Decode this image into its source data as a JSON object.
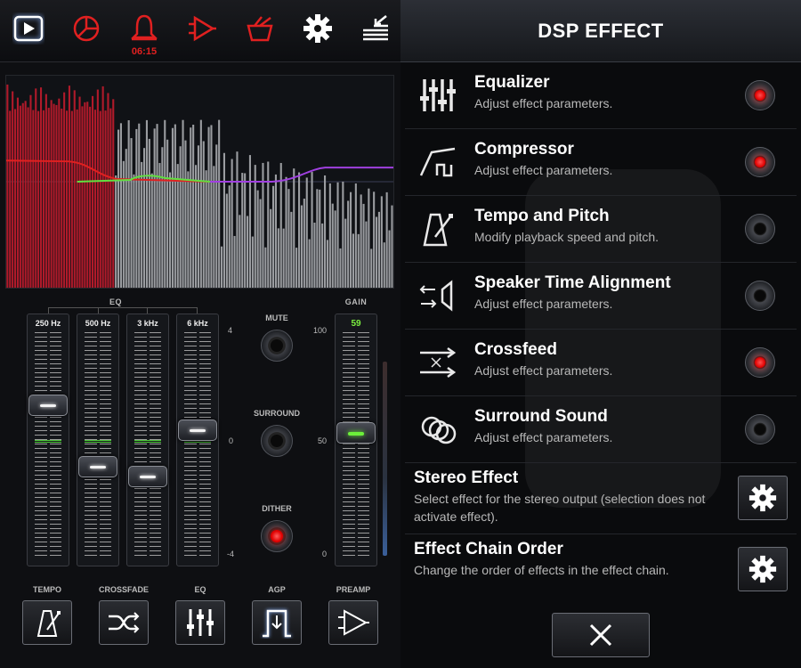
{
  "toolbar": {
    "alarm_time": "06:15",
    "icons": [
      "play-icon",
      "timer-icon",
      "alarm-bell-icon",
      "dsp-amp-icon",
      "library-icon",
      "settings-gear-icon",
      "queue-icon"
    ]
  },
  "spectrum": {
    "bars": [
      120,
      120,
      120,
      120,
      120,
      120,
      120,
      120,
      120,
      120,
      120,
      120,
      120,
      120,
      120,
      120,
      120,
      120,
      120,
      120,
      120,
      120,
      120,
      120,
      120,
      120,
      120,
      120,
      120,
      120,
      120,
      120,
      120,
      120,
      120,
      120,
      120,
      120,
      120,
      120,
      120,
      120,
      120,
      120,
      120,
      120,
      120,
      120,
      120,
      120,
      120,
      120,
      120,
      120,
      120,
      120,
      120,
      120,
      120,
      120,
      120,
      120,
      120,
      120,
      120,
      120,
      120,
      120,
      120,
      120,
      120,
      120,
      120,
      120,
      120,
      120,
      120,
      120,
      120,
      120,
      120,
      120,
      120,
      120,
      120,
      120,
      120,
      120,
      120,
      120,
      120,
      120,
      120,
      120,
      120,
      120,
      120,
      120,
      120,
      120,
      120,
      120,
      120,
      120,
      120,
      120,
      120,
      120,
      120,
      120,
      120,
      120,
      120,
      120,
      120,
      120,
      120,
      120,
      120,
      120,
      120,
      120,
      120,
      120,
      120,
      120,
      120,
      120,
      120,
      120,
      120,
      120,
      120,
      120,
      120,
      120,
      120,
      120,
      120,
      120,
      120,
      120,
      120,
      120,
      120,
      120,
      120,
      120,
      120,
      120,
      120,
      120,
      120,
      120,
      120,
      120,
      120,
      120,
      120,
      120
    ],
    "colors": {
      "bar": "#9a9ca0",
      "bar_top": "#b01a2a",
      "curve_red": "#e02020",
      "curve_green": "#60e040",
      "curve_purple": "#a040e0"
    }
  },
  "eq": {
    "section_label": "EQ",
    "bands": [
      {
        "label": "250 Hz",
        "level": 0.72
      },
      {
        "label": "500 Hz",
        "level": 0.43
      },
      {
        "label": "3 kHz",
        "level": 0.38
      },
      {
        "label": "6 kHz",
        "level": 0.6
      }
    ],
    "scale": {
      "top": "4",
      "mid": "0",
      "bottom": "-4"
    }
  },
  "toggles": [
    {
      "label": "MUTE",
      "on": false
    },
    {
      "label": "SURROUND",
      "on": false
    },
    {
      "label": "DITHER",
      "on": true
    }
  ],
  "gain": {
    "label": "GAIN",
    "value": "59",
    "level": 0.59,
    "scale": {
      "top": "100",
      "mid": "50",
      "bottom": "0"
    }
  },
  "bottom_buttons": [
    {
      "label": "TEMPO",
      "icon": "metronome-icon"
    },
    {
      "label": "CROSSFADE",
      "icon": "crossfade-icon"
    },
    {
      "label": "EQ",
      "icon": "equalizer-icon"
    },
    {
      "label": "AGP",
      "icon": "agp-icon"
    },
    {
      "label": "PREAMP",
      "icon": "preamp-icon"
    }
  ],
  "dsp": {
    "title": "DSP EFFECT",
    "effects": [
      {
        "title": "Equalizer",
        "subtitle": "Adjust effect parameters.",
        "on": true,
        "icon": "equalizer-icon"
      },
      {
        "title": "Compressor",
        "subtitle": "Adjust effect parameters.",
        "on": true,
        "icon": "compressor-icon"
      },
      {
        "title": "Tempo and Pitch",
        "subtitle": "Modify playback speed and pitch.",
        "on": false,
        "icon": "metronome-icon"
      },
      {
        "title": "Speaker Time Alignment",
        "subtitle": "Adjust effect parameters.",
        "on": false,
        "icon": "speaker-alignment-icon"
      },
      {
        "title": "Crossfeed",
        "subtitle": "Adjust effect parameters.",
        "on": true,
        "icon": "crossfeed-icon"
      },
      {
        "title": "Surround Sound",
        "subtitle": "Adjust effect parameters.",
        "on": false,
        "icon": "surround-icon"
      }
    ],
    "options": [
      {
        "title": "Stereo Effect",
        "subtitle": "Select effect for the stereo output (selection does not activate effect)."
      },
      {
        "title": "Effect Chain Order",
        "subtitle": "Change the order of effects in the effect chain."
      }
    ]
  }
}
